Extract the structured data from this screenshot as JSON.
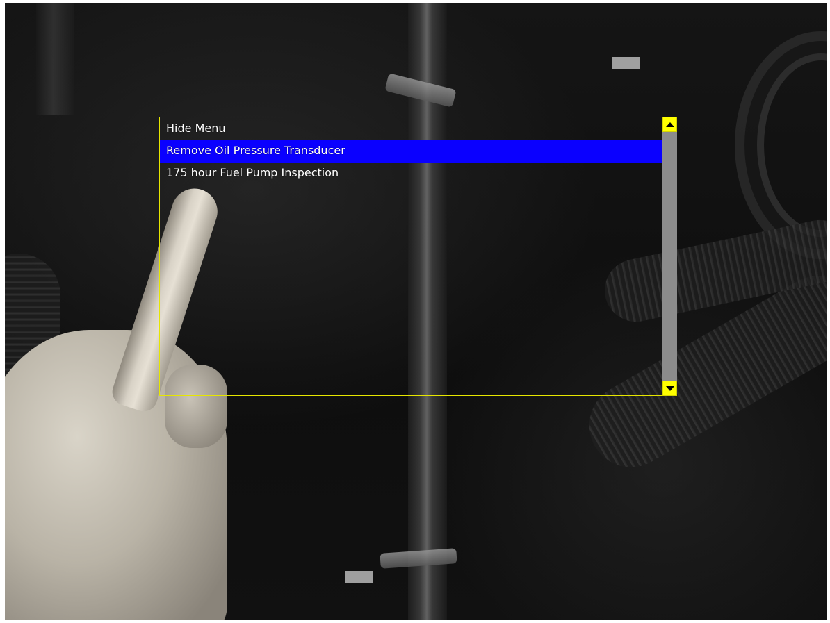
{
  "menu": {
    "items": [
      {
        "label": "Hide Menu",
        "selected": false
      },
      {
        "label": "Remove Oil Pressure Transducer",
        "selected": true
      },
      {
        "label": "175 hour Fuel Pump Inspection",
        "selected": false
      }
    ],
    "border_color": "#e6e600",
    "highlight_color": "#0a00ff",
    "text_color": "#ffffff"
  },
  "scrollbar": {
    "up_icon": "triangle-up-icon",
    "down_icon": "triangle-down-icon",
    "button_color": "#ffff00",
    "track_color": "#9a9a9a"
  }
}
